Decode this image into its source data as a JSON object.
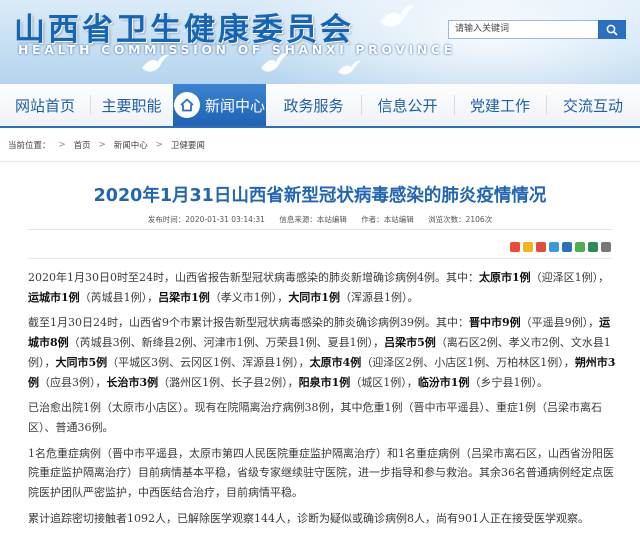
{
  "header": {
    "title": "山西省卫生健康委员会",
    "subtitle": "HEALTH COMMISSION OF SHANXI PROVINCE",
    "search_placeholder": "请输入关键词"
  },
  "nav": {
    "items": [
      {
        "label": "网站首页"
      },
      {
        "label": "主要职能"
      },
      {
        "label": "新闻中心"
      },
      {
        "label": "政务服务"
      },
      {
        "label": "信息公开"
      },
      {
        "label": "党建工作"
      },
      {
        "label": "交流互动"
      }
    ],
    "active_index": 2
  },
  "breadcrumb": {
    "prefix": "当前位置：",
    "items": [
      "首页",
      "新闻中心",
      "卫健要闻"
    ],
    "separator": ">"
  },
  "article": {
    "title": "2020年1月31日山西省新型冠状病毒感染的肺炎疫情情况",
    "meta": {
      "publish": "发布时间：2020-01-31 03:14:31",
      "source": "信息来源：本站编辑",
      "author": "作者：本站编辑",
      "views": "浏览次数：2106次"
    },
    "paragraphs": [
      [
        {
          "t": "2020年1月30日0时至24时，山西省报告新型冠状病毒感染的肺炎新增确诊病例4例。其中："
        },
        {
          "t": "太原市1例",
          "b": true
        },
        {
          "t": "（迎泽区1例），"
        },
        {
          "t": "运城市1例",
          "b": true
        },
        {
          "t": "（芮城县1例），"
        },
        {
          "t": "吕梁市1例",
          "b": true
        },
        {
          "t": "（孝义市1例），"
        },
        {
          "t": "大同市1例",
          "b": true
        },
        {
          "t": "（浑源县1例）。"
        }
      ],
      [
        {
          "t": "截至1月30日24时，山西省9个市累计报告新型冠状病毒感染的肺炎确诊病例39例。其中："
        },
        {
          "t": "晋中市9例",
          "b": true
        },
        {
          "t": "（平遥县9例），"
        },
        {
          "t": "运城市8例",
          "b": true
        },
        {
          "t": "（芮城县3例、新绛县2例、河津市1例、万荣县1例、夏县1例），"
        },
        {
          "t": "吕梁市5例",
          "b": true
        },
        {
          "t": "（离石区2例、孝义市2例、文水县1例），"
        },
        {
          "t": "大同市5例",
          "b": true
        },
        {
          "t": "（平城区3例、云冈区1例、浑源县1例），"
        },
        {
          "t": "太原市4例",
          "b": true
        },
        {
          "t": "（迎泽区2例、小店区1例、万柏林区1例），"
        },
        {
          "t": "朔州市3例",
          "b": true
        },
        {
          "t": "（应县3例），"
        },
        {
          "t": "长治市3例",
          "b": true
        },
        {
          "t": "（潞州区1例、长子县2例），"
        },
        {
          "t": "阳泉市1例",
          "b": true
        },
        {
          "t": "（城区1例），"
        },
        {
          "t": "临汾市1例",
          "b": true
        },
        {
          "t": "（乡宁县1例）。"
        }
      ],
      [
        {
          "t": "已治愈出院1例（太原市小店区）。现有在院隔离治疗病例38例，其中危重1例（晋中市平遥县）、重症1例（吕梁市离石区）、普通36例。"
        }
      ],
      [
        {
          "t": "1名危重症病例（晋中市平遥县，太原市第四人民医院重症监护隔离治疗）和1名重症病例（吕梁市离石区，山西省汾阳医院重症监护隔离治疗）目前病情基本平稳，省级专家继续驻守医院，进一步指导和参与救治。其余36名普通病例经定点医院医护团队严密监护，中西医结合治疗，目前病情平稳。"
        }
      ],
      [
        {
          "t": "累计追踪密切接触者1092人，已解除医学观察144人，诊断为疑似或确诊病例8人，尚有901人正在接受医学观察。"
        }
      ]
    ]
  },
  "colors": {
    "brand_blue": "#2b70c0",
    "title_blue": "#2266b3",
    "header_title": "#1565b6"
  },
  "icons": {
    "search": "search-icon",
    "home": "home-icon",
    "share": [
      "share-more-icon",
      "share-qzone-icon",
      "share-weibo-icon",
      "share-tencent-icon",
      "share-renren-icon",
      "share-wechat-icon",
      "share-douban-icon",
      "share-print-icon"
    ]
  }
}
